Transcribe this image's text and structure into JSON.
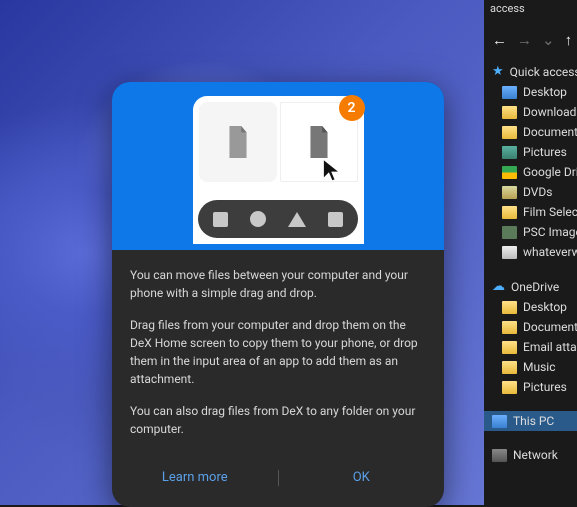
{
  "panel": {
    "top_line1": "access",
    "nav_back": "←",
    "nav_fwd": "→",
    "nav_drop": "⌄",
    "nav_up": "↑"
  },
  "tree": {
    "quick_access": "Quick access",
    "desktop": "Desktop",
    "downloads": "Downloads",
    "documents": "Documents",
    "pictures": "Pictures",
    "google_drive": "Google Dri",
    "dvds": "DVDs",
    "film_select": "Film Select",
    "psc_images": "PSC Image",
    "whatever": "whateverwa",
    "onedrive": "OneDrive",
    "od_desktop": "Desktop",
    "od_documents": "Documents",
    "od_email": "Email attac",
    "od_music": "Music",
    "od_pictures": "Pictures",
    "this_pc": "This PC",
    "network": "Network"
  },
  "dialog": {
    "badge": "2",
    "p1": "You can move files between your computer and your phone with a simple drag and drop.",
    "p2": "Drag files from your computer and drop them on the DeX Home screen to copy them to your phone, or drop them in the input area of an app to add them as an attachment.",
    "p3": "You can also drag files from DeX to any folder on your computer.",
    "learn_more": "Learn more",
    "ok": "OK"
  }
}
